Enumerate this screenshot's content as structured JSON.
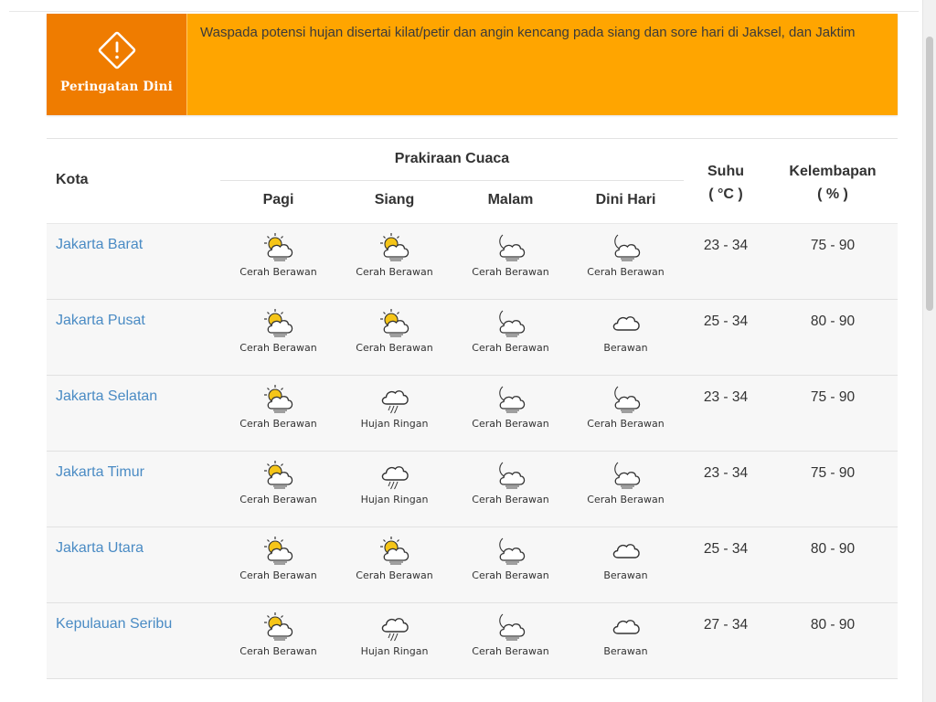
{
  "warning": {
    "title": "Peringatan Dini",
    "text": "Waspada potensi hujan disertai kilat/petir dan angin kencang pada siang dan sore hari di Jaksel, dan Jaktim",
    "badge_color": "#ef7c00",
    "banner_color": "#ffa500",
    "icon": "warning-icon"
  },
  "table": {
    "col_kota": "Kota",
    "col_prakiraan": "Prakiraan Cuaca",
    "periods": [
      "Pagi",
      "Siang",
      "Malam",
      "Dini Hari"
    ],
    "col_suhu": "Suhu",
    "col_suhu_unit": "( °C )",
    "col_kelembapan": "Kelembapan",
    "col_kelembapan_unit": "( % )",
    "rows": [
      {
        "city": "Jakarta Barat",
        "forecast": [
          {
            "label": "Cerah Berawan",
            "icon": "partly-cloudy-day-icon"
          },
          {
            "label": "Cerah Berawan",
            "icon": "partly-cloudy-day-icon"
          },
          {
            "label": "Cerah Berawan",
            "icon": "partly-cloudy-night-icon"
          },
          {
            "label": "Cerah Berawan",
            "icon": "partly-cloudy-night-icon"
          }
        ],
        "suhu": "23 - 34",
        "kelembapan": "75 - 90"
      },
      {
        "city": "Jakarta Pusat",
        "forecast": [
          {
            "label": "Cerah Berawan",
            "icon": "partly-cloudy-day-icon"
          },
          {
            "label": "Cerah Berawan",
            "icon": "partly-cloudy-day-icon"
          },
          {
            "label": "Cerah Berawan",
            "icon": "partly-cloudy-night-icon"
          },
          {
            "label": "Berawan",
            "icon": "cloudy-icon"
          }
        ],
        "suhu": "25 - 34",
        "kelembapan": "80 - 90"
      },
      {
        "city": "Jakarta Selatan",
        "forecast": [
          {
            "label": "Cerah Berawan",
            "icon": "partly-cloudy-day-icon"
          },
          {
            "label": "Hujan Ringan",
            "icon": "light-rain-icon"
          },
          {
            "label": "Cerah Berawan",
            "icon": "partly-cloudy-night-icon"
          },
          {
            "label": "Cerah Berawan",
            "icon": "partly-cloudy-night-icon"
          }
        ],
        "suhu": "23 - 34",
        "kelembapan": "75 - 90"
      },
      {
        "city": "Jakarta Timur",
        "forecast": [
          {
            "label": "Cerah Berawan",
            "icon": "partly-cloudy-day-icon"
          },
          {
            "label": "Hujan Ringan",
            "icon": "light-rain-icon"
          },
          {
            "label": "Cerah Berawan",
            "icon": "partly-cloudy-night-icon"
          },
          {
            "label": "Cerah Berawan",
            "icon": "partly-cloudy-night-icon"
          }
        ],
        "suhu": "23 - 34",
        "kelembapan": "75 - 90"
      },
      {
        "city": "Jakarta Utara",
        "forecast": [
          {
            "label": "Cerah Berawan",
            "icon": "partly-cloudy-day-icon"
          },
          {
            "label": "Cerah Berawan",
            "icon": "partly-cloudy-day-icon"
          },
          {
            "label": "Cerah Berawan",
            "icon": "partly-cloudy-night-icon"
          },
          {
            "label": "Berawan",
            "icon": "cloudy-icon"
          }
        ],
        "suhu": "25 - 34",
        "kelembapan": "80 - 90"
      },
      {
        "city": "Kepulauan Seribu",
        "forecast": [
          {
            "label": "Cerah Berawan",
            "icon": "partly-cloudy-day-icon"
          },
          {
            "label": "Hujan Ringan",
            "icon": "light-rain-icon"
          },
          {
            "label": "Cerah Berawan",
            "icon": "partly-cloudy-night-icon"
          },
          {
            "label": "Berawan",
            "icon": "cloudy-icon"
          }
        ],
        "suhu": "27 - 34",
        "kelembapan": "80 - 90"
      }
    ]
  },
  "colors": {
    "city_link": "#4a8bc4",
    "row_background": "#f7f7f7",
    "sun": "#f5c518"
  }
}
